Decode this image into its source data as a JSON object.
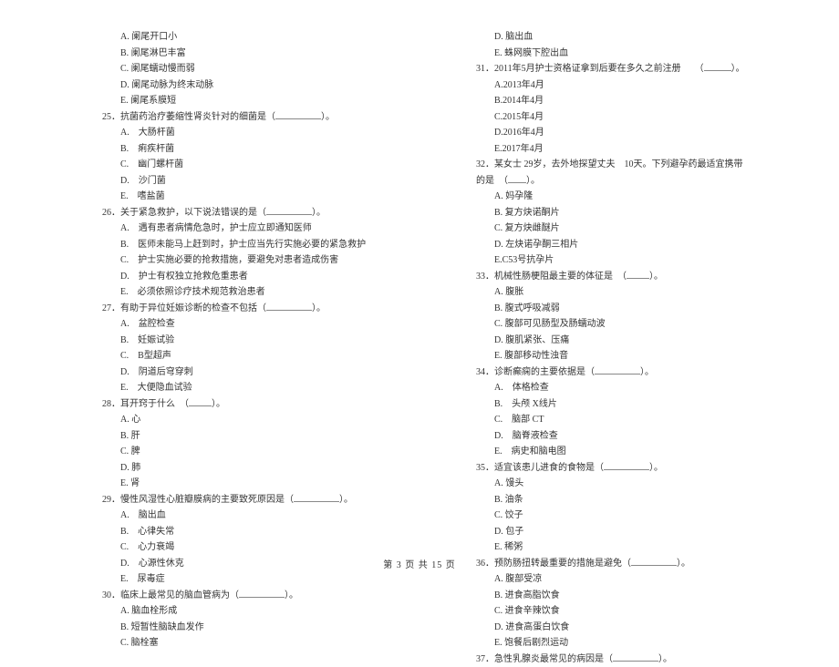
{
  "left": {
    "pre": [
      "A. 阑尾开口小",
      "B. 阑尾淋巴丰富",
      "C. 阑尾蠕动慢而弱",
      "D. 阑尾动脉为终末动脉",
      "E. 阑尾系膜短"
    ],
    "q25": {
      "stem": "25．抗菌药治疗萎缩性肾炎针对的细菌是（",
      "tail": "）。",
      "opts": [
        "A.　大肠杆菌",
        "B.　痢疾杆菌",
        "C.　幽门螺杆菌",
        "D.　沙门菌",
        "E.　嗜盐菌"
      ]
    },
    "q26": {
      "stem": "26．关于紧急救护，以下说法错误的是（",
      "tail": "）。",
      "opts": [
        "A.　遇有患者病情危急时，护士应立即通知医师",
        "B.　医师未能马上赶到时，护士应当先行实施必要的紧急救护",
        "C.　护士实施必要的抢救措施，要避免对患者造成伤害",
        "D.　护士有权独立抢救危重患者",
        "E.　必须依照诊疗技术规范救治患者"
      ]
    },
    "q27": {
      "stem": "27．有助于异位妊娠诊断的检查不包括（",
      "tail": "）。",
      "opts": [
        "A.　盆腔检查",
        "B.　妊娠试验",
        "C.　B型超声",
        "D.　阴道后穹穿刺",
        "E.　大便隐血试验"
      ]
    },
    "q28": {
      "stem": "28．耳开窍于什么　（",
      "tail": "）。",
      "opts": [
        "A. 心",
        "B. 肝",
        "C. 脾",
        "D. 肺",
        "E. 肾"
      ]
    },
    "q29": {
      "stem": "29．慢性风湿性心脏瓣膜病的主要致死原因是（",
      "tail": "）。",
      "opts": [
        "A.　脑出血",
        "B.　心律失常",
        "C.　心力衰竭",
        "D.　心源性休克",
        "E.　尿毒症"
      ]
    },
    "q30": {
      "stem": "30．临床上最常见的脑血管病为（",
      "tail": "）。",
      "opts": [
        "A. 脑血栓形成",
        "B. 短暂性脑缺血发作",
        "C. 脑栓塞"
      ]
    }
  },
  "right": {
    "pre": [
      "D. 脑出血",
      "E. 蛛网膜下腔出血"
    ],
    "q31": {
      "stem": "31．2011年5月护士资格证拿到后要在多久之前注册　　（",
      "tail": "）。",
      "opts": [
        "A.2013年4月",
        "B.2014年4月",
        "C.2015年4月",
        "D.2016年4月",
        "E.2017年4月"
      ]
    },
    "q32": {
      "stem": "32．某女士 29岁，去外地探望丈夫　10天。下列避孕药最适宜携带的是　（",
      "tail": "）。",
      "opts": [
        "A. 妈孕隆",
        "B. 复方炔诺酮片",
        "C. 复方炔雌醚片",
        "D. 左炔诺孕酮三相片",
        "E.C53号抗孕片"
      ]
    },
    "q33": {
      "stem": "33．机械性肠梗阻最主要的体征是　（",
      "tail": "）。",
      "opts": [
        "A. 腹胀",
        "B. 腹式呼吸减弱",
        "C. 腹部可见肠型及肠蠕动波",
        "D. 腹肌紧张、压痛",
        "E. 腹部移动性浊音"
      ]
    },
    "q34": {
      "stem": "34．诊断癫痫的主要依据是（",
      "tail": "）。",
      "opts": [
        "A.　体格检查",
        "B.　头颅 X线片",
        "C.　脑部 CT",
        "D.　脑脊液检查",
        "E.　病史和脑电图"
      ]
    },
    "q35": {
      "stem": "35．适宜该患儿进食的食物是（",
      "tail": "）。",
      "opts": [
        "A. 馒头",
        "B. 油条",
        "C. 饺子",
        "D. 包子",
        "E. 稀粥"
      ]
    },
    "q36": {
      "stem": "36．预防肠扭转最重要的措施是避免（",
      "tail": "）。",
      "opts": [
        "A. 腹部受凉",
        "B. 进食高脂饮食",
        "C. 进食辛辣饮食",
        "D. 进食高蛋白饮食",
        "E. 饱餐后剧烈运动"
      ]
    },
    "q37": {
      "stem": "37．急性乳腺炎最常见的病因是（",
      "tail": "）。"
    }
  },
  "footer": "第 3 页 共 15 页"
}
